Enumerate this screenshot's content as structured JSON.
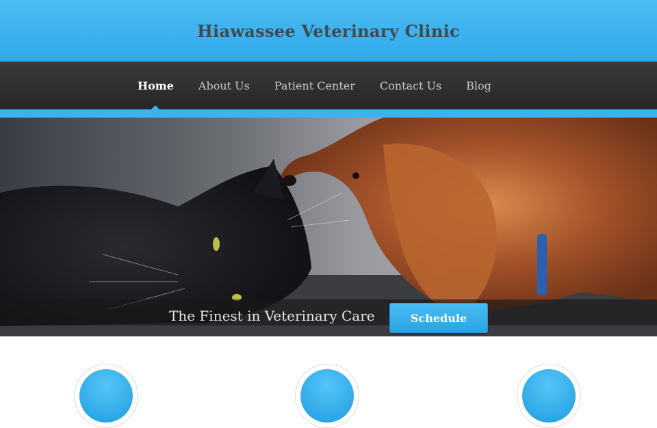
{
  "site": {
    "title": "Hiawassee Veterinary Clinic"
  },
  "nav": {
    "items": [
      {
        "label": "Home",
        "active": true
      },
      {
        "label": "About Us",
        "active": false
      },
      {
        "label": "Patient Center",
        "active": false
      },
      {
        "label": "Contact Us",
        "active": false
      },
      {
        "label": "Blog",
        "active": false
      }
    ]
  },
  "hero": {
    "image": "black-cat-and-spaniel-dog-photo",
    "caption": "The Finest in Veterinary Care",
    "button_label": "Schedule"
  },
  "features": [
    {
      "icon": "blue-circle-icon"
    },
    {
      "icon": "blue-circle-icon"
    },
    {
      "icon": "blue-circle-icon"
    }
  ],
  "colors": {
    "accent": "#3cb2ee",
    "header_bg": "#3fb4ee",
    "nav_bg": "#2e2e2e",
    "title_text": "#3e4b55"
  }
}
